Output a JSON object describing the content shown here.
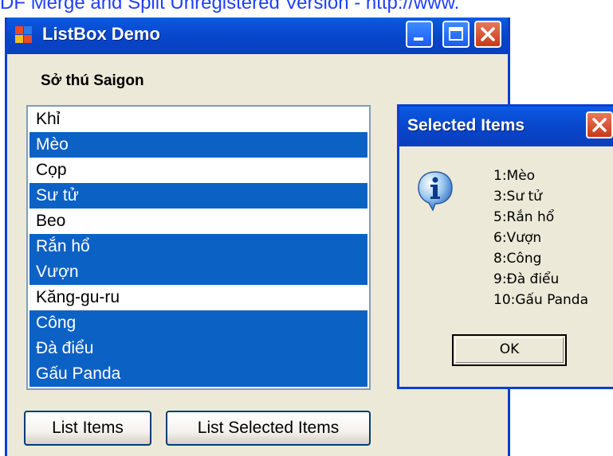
{
  "watermark": "DF Merge and Split Unregistered Version - http://www.",
  "window": {
    "title": "ListBox Demo",
    "label": "Sở thú Saigon",
    "items": [
      {
        "text": "Khỉ",
        "selected": false
      },
      {
        "text": "Mèo",
        "selected": true
      },
      {
        "text": "Cọp",
        "selected": false
      },
      {
        "text": "Sư tử",
        "selected": true
      },
      {
        "text": "Beo",
        "selected": false
      },
      {
        "text": "Rắn hổ",
        "selected": true
      },
      {
        "text": "Vượn",
        "selected": true
      },
      {
        "text": "Kăng-gu-ru",
        "selected": false
      },
      {
        "text": "Công",
        "selected": true
      },
      {
        "text": "Đà điểu",
        "selected": true
      },
      {
        "text": "Gấu Panda",
        "selected": true
      }
    ],
    "buttons": {
      "list_items": "List Items",
      "list_selected": "List Selected Items"
    }
  },
  "dialog": {
    "title": "Selected Items",
    "lines": [
      "1:Mèo",
      "3:Sư tử",
      "5:Rắn hổ",
      "6:Vượn",
      "8:Công",
      "9:Đà điểu",
      "10:Gấu Panda"
    ],
    "ok_label": "OK"
  },
  "icons": {
    "app": "app-window-icon",
    "minimize": "minimize-icon",
    "maximize": "maximize-icon",
    "close": "close-icon",
    "info": "info-icon"
  },
  "colors": {
    "titlebar": "#0a55dd",
    "selection": "#0c61c5",
    "close_button": "#d9502e",
    "dialog_bg": "#ece9d8"
  }
}
